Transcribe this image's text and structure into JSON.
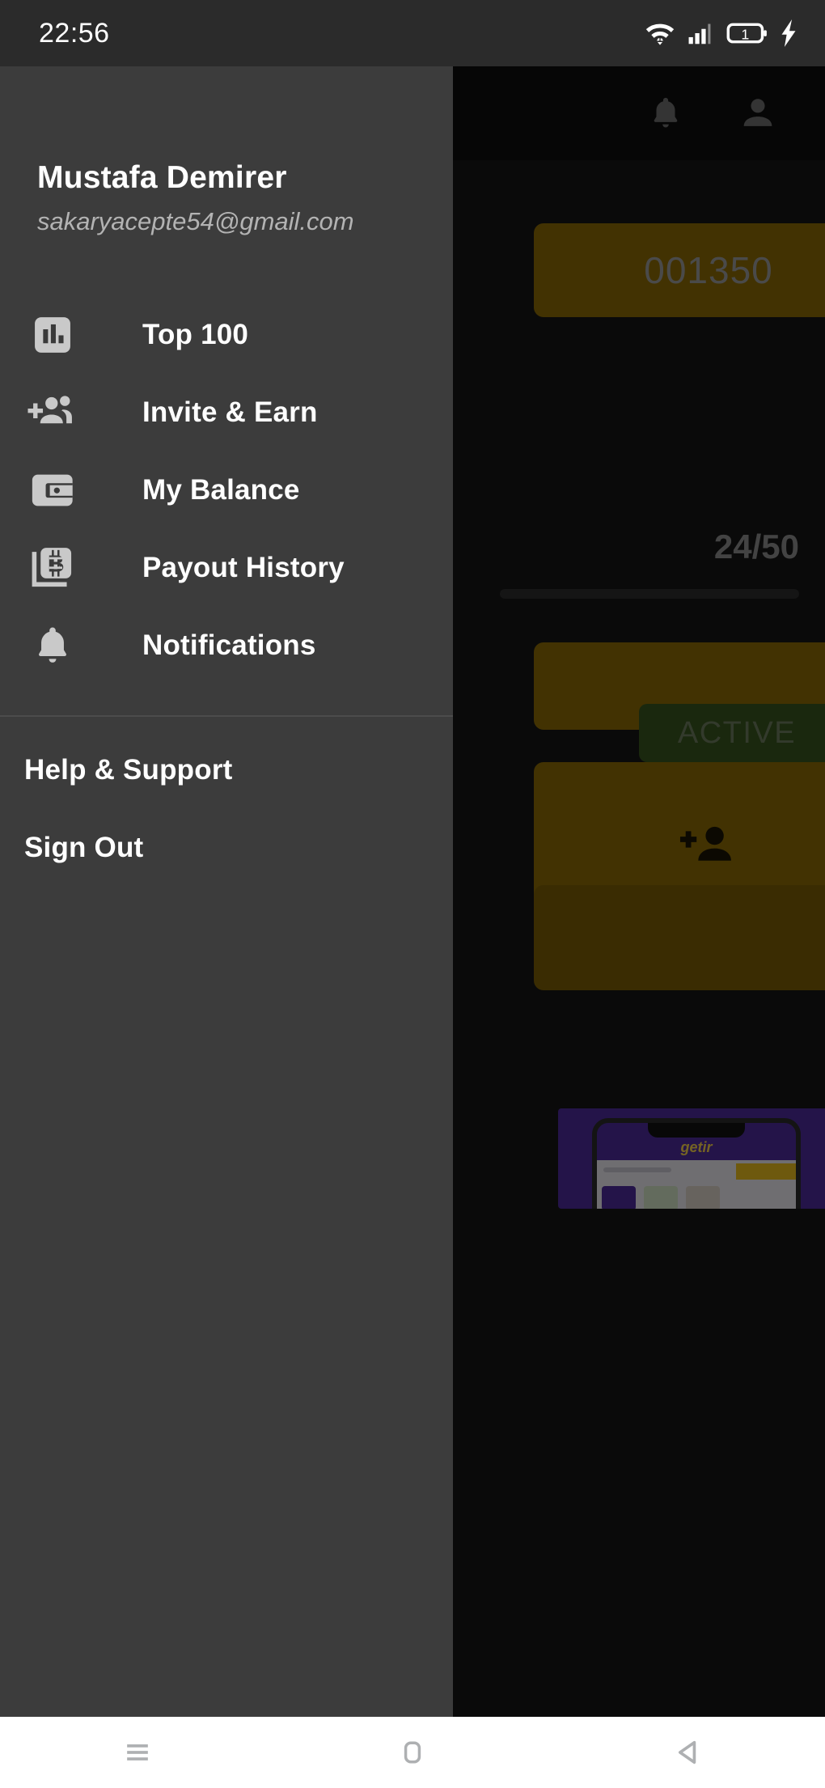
{
  "status_bar": {
    "clock": "22:56",
    "icons": [
      {
        "name": "wifi-icon",
        "label": "wifi"
      },
      {
        "name": "signal-icon",
        "label": "cellular-signal"
      },
      {
        "name": "battery-icon",
        "label": "battery",
        "text": "1"
      },
      {
        "name": "charging-bolt-icon",
        "label": "charging"
      }
    ]
  },
  "drawer": {
    "user": {
      "name": "Mustafa Demirer",
      "email": "sakaryacepte54@gmail.com"
    },
    "items": [
      {
        "icon": "bar-chart-icon",
        "label": "Top 100"
      },
      {
        "icon": "group-add-icon",
        "label": "Invite & Earn"
      },
      {
        "icon": "wallet-icon",
        "label": "My Balance"
      },
      {
        "icon": "bitcoin-cards-icon",
        "label": "Payout History"
      },
      {
        "icon": "bell-icon",
        "label": "Notifications"
      }
    ],
    "secondary": [
      {
        "label": "Help & Support"
      },
      {
        "label": "Sign Out"
      }
    ],
    "background_color": "#3c3c3c",
    "text_color": "#ffffff"
  },
  "background_app": {
    "app_bar_icons": [
      {
        "name": "bell-icon",
        "label": "notifications"
      },
      {
        "name": "person-icon",
        "label": "profile"
      }
    ],
    "balance_card": {
      "value": "001350",
      "color": "#8a6a06"
    },
    "progress": {
      "label": "24/50",
      "current": 24,
      "total": 50
    },
    "status_badge": {
      "label": "ACTIVE",
      "color": "#37541f"
    },
    "invite_card": {
      "icon": "person-add-icon",
      "color": "#8a6a06"
    },
    "plain_card": {
      "color": "#7a5d05"
    },
    "ad_banner": {
      "brand": "getir",
      "color": "#4b2a9a"
    }
  },
  "nav_bar": {
    "buttons": [
      {
        "name": "recents-button",
        "icon": "menu-lines-icon"
      },
      {
        "name": "home-button",
        "icon": "rounded-square-icon"
      },
      {
        "name": "back-button",
        "icon": "triangle-left-icon"
      }
    ]
  }
}
